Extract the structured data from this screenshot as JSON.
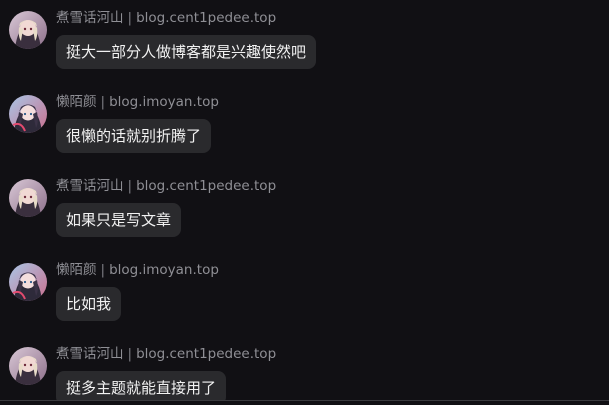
{
  "messages": [
    {
      "sender": "煮雪话河山",
      "separator": "|",
      "site": "blog.cent1pedee.top",
      "text": "挺大一部分人做博客都是兴趣使然吧",
      "avatar_icon": "anime-girl-avatar-icon"
    },
    {
      "sender": "懒陌颜",
      "separator": "|",
      "site": "blog.imoyan.top",
      "text": "很懒的话就别折腾了",
      "avatar_icon": "anime-girl-avatar-icon"
    },
    {
      "sender": "煮雪话河山",
      "separator": "|",
      "site": "blog.cent1pedee.top",
      "text": "如果只是写文章",
      "avatar_icon": "anime-girl-avatar-icon"
    },
    {
      "sender": "懒陌颜",
      "separator": "|",
      "site": "blog.imoyan.top",
      "text": "比如我",
      "avatar_icon": "anime-girl-avatar-icon"
    },
    {
      "sender": "煮雪话河山",
      "separator": "|",
      "site": "blog.cent1pedee.top",
      "text": "挺多主题就能直接用了",
      "avatar_icon": "anime-girl-avatar-icon"
    }
  ],
  "colors": {
    "background": "#111014",
    "bubble": "#2a2a2d",
    "message_text": "#f2f2f2",
    "meta_text": "#8f8f95"
  }
}
